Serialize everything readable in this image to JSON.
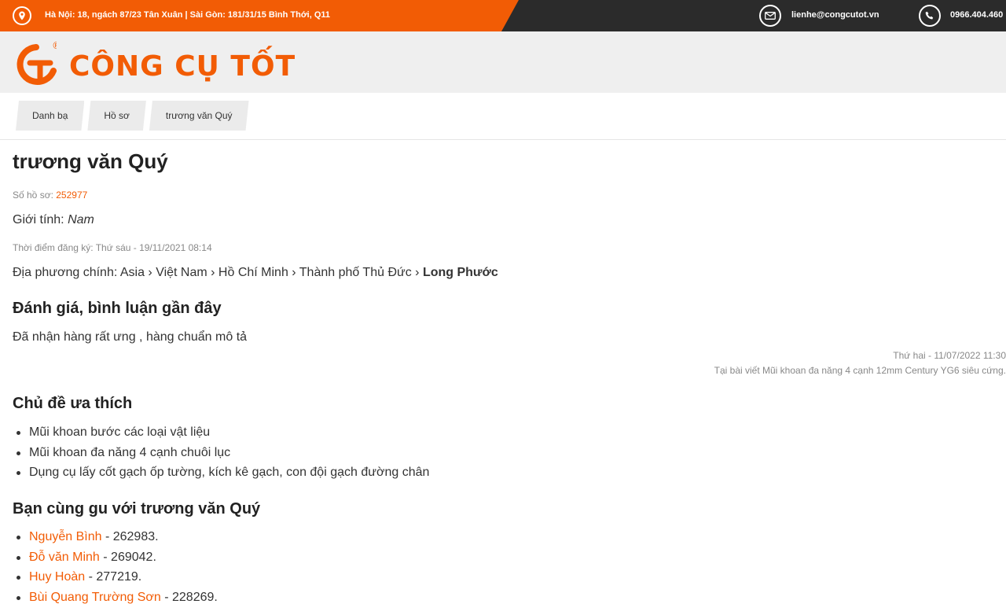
{
  "topbar": {
    "address": "Hà Nội: 18, ngách 87/23 Tân Xuân | Sài Gòn: 181/31/15 Bình Thới, Q11",
    "email": "lienhe@congcutot.vn",
    "phone": "0966.404.460",
    "icons": [
      "location-icon",
      "mail-icon",
      "phone-icon"
    ],
    "colors": {
      "accent": "#f25c05",
      "dark": "#2b2b2b"
    }
  },
  "logo": {
    "mark": "G T",
    "text": "CÔNG CỤ TỐT",
    "registered": "®"
  },
  "breadcrumb": [
    "Danh bạ",
    "Hồ sơ",
    "trương văn Quý"
  ],
  "profile": {
    "name": "trương văn Quý",
    "file_label": "Số hồ sơ:",
    "file_number": "252977",
    "gender_label": "Giới tính:",
    "gender": "Nam",
    "registered": "Thời điểm đăng ký: Thứ sáu - 19/11/2021 08:14",
    "location_label": "Địa phương chính:",
    "location_path": "Asia › Việt Nam › Hồ Chí Minh › Thành phố Thủ Đức ›",
    "location_last": "Long Phước"
  },
  "reviews": {
    "heading": "Đánh giá, bình luận gần đây",
    "items": [
      {
        "text": "Đã nhận hàng rất ưng , hàng chuẩn mô tả",
        "date": "Thứ hai - 11/07/2022 11:30",
        "source": "Tại bài viết Mũi khoan đa năng 4 cạnh 12mm Century YG6 siêu cứng."
      }
    ]
  },
  "topics": {
    "heading": "Chủ đề ưa thích",
    "items": [
      "Mũi khoan bước các loại vật liệu",
      "Mũi khoan đa năng 4 cạnh chuôi lục",
      "Dụng cụ lấy cốt gạch ốp tường, kích kê gạch, con đội gạch đường chân"
    ]
  },
  "friends": {
    "heading": "Bạn cùng gu với trương văn Quý",
    "items": [
      {
        "name": "Nguyễn Bình",
        "id": " - 262983."
      },
      {
        "name": "Đỗ văn Minh",
        "id": " - 269042."
      },
      {
        "name": "Huy Hoàn",
        "id": " - 277219."
      },
      {
        "name": "Bùi Quang Trường Sơn",
        "id": " - 228269."
      }
    ]
  }
}
